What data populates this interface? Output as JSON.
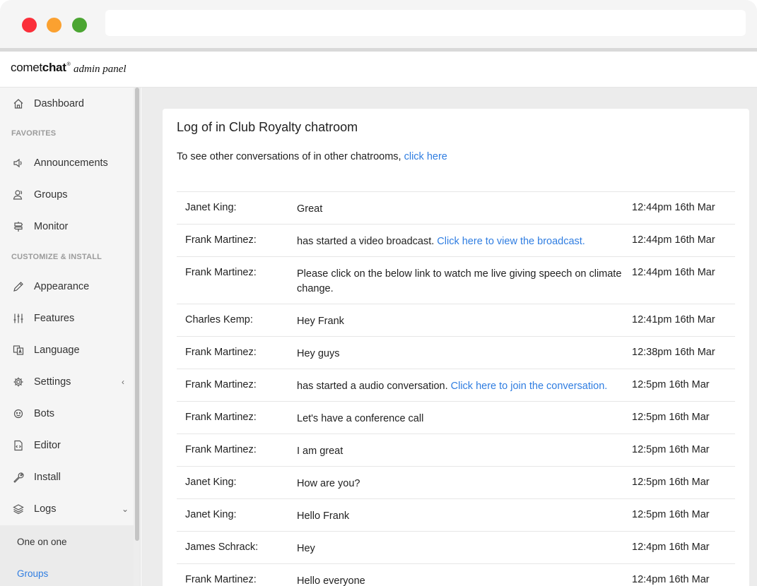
{
  "browser": {
    "address": ""
  },
  "header": {
    "brand_light": "comet",
    "brand_bold": "chat",
    "brand_mark": "®",
    "subtitle": "admin panel"
  },
  "sidebar": {
    "dashboard": "Dashboard",
    "favorites_heading": "FAVORITES",
    "favorites": [
      "Announcements",
      "Groups",
      "Monitor"
    ],
    "customize_heading": "CUSTOMIZE & INSTALL",
    "customize": [
      "Appearance",
      "Features",
      "Language",
      "Settings",
      "Bots",
      "Editor",
      "Install",
      "Logs"
    ],
    "settings_caret": "‹",
    "logs_caret": "⌄",
    "logs_sub": [
      "One on one",
      "Groups"
    ]
  },
  "colors": {
    "link": "#2f7de1",
    "sub_active": "#2f7de1"
  },
  "main": {
    "title": "Log of in Club Royalty chatroom",
    "subtitle_prefix": "To see other conversations of in other chatrooms, ",
    "subtitle_link": "click here",
    "rows": [
      {
        "name": "Janet King:",
        "message": "Great",
        "link": "",
        "time": "12:44pm 16th Mar"
      },
      {
        "name": "Frank Martinez:",
        "message": "has started a video broadcast.",
        "link": "Click here to view the broadcast.",
        "time": "12:44pm 16th Mar"
      },
      {
        "name": "Frank Martinez:",
        "message": "Please click on the below link to watch me live giving speech on climate change.",
        "link": "",
        "time": "12:44pm 16th Mar"
      },
      {
        "name": "Charles Kemp:",
        "message": "Hey Frank",
        "link": "",
        "time": "12:41pm 16th Mar"
      },
      {
        "name": "Frank Martinez:",
        "message": "Hey guys",
        "link": "",
        "time": "12:38pm 16th Mar"
      },
      {
        "name": "Frank Martinez:",
        "message": "has started a audio conversation.",
        "link": "Click here to join the conversation.",
        "time": "12:5pm 16th Mar"
      },
      {
        "name": "Frank Martinez:",
        "message": "Let's have a conference call",
        "link": "",
        "time": "12:5pm 16th Mar"
      },
      {
        "name": "Frank Martinez:",
        "message": "I am great",
        "link": "",
        "time": "12:5pm 16th Mar"
      },
      {
        "name": "Janet King:",
        "message": "How are you?",
        "link": "",
        "time": "12:5pm 16th Mar"
      },
      {
        "name": "Janet King:",
        "message": "Hello Frank",
        "link": "",
        "time": "12:5pm 16th Mar"
      },
      {
        "name": "James Schrack:",
        "message": "Hey",
        "link": "",
        "time": "12:4pm 16th Mar"
      },
      {
        "name": "Frank Martinez:",
        "message": "Hello everyone",
        "link": "",
        "time": "12:4pm 16th Mar"
      }
    ]
  }
}
